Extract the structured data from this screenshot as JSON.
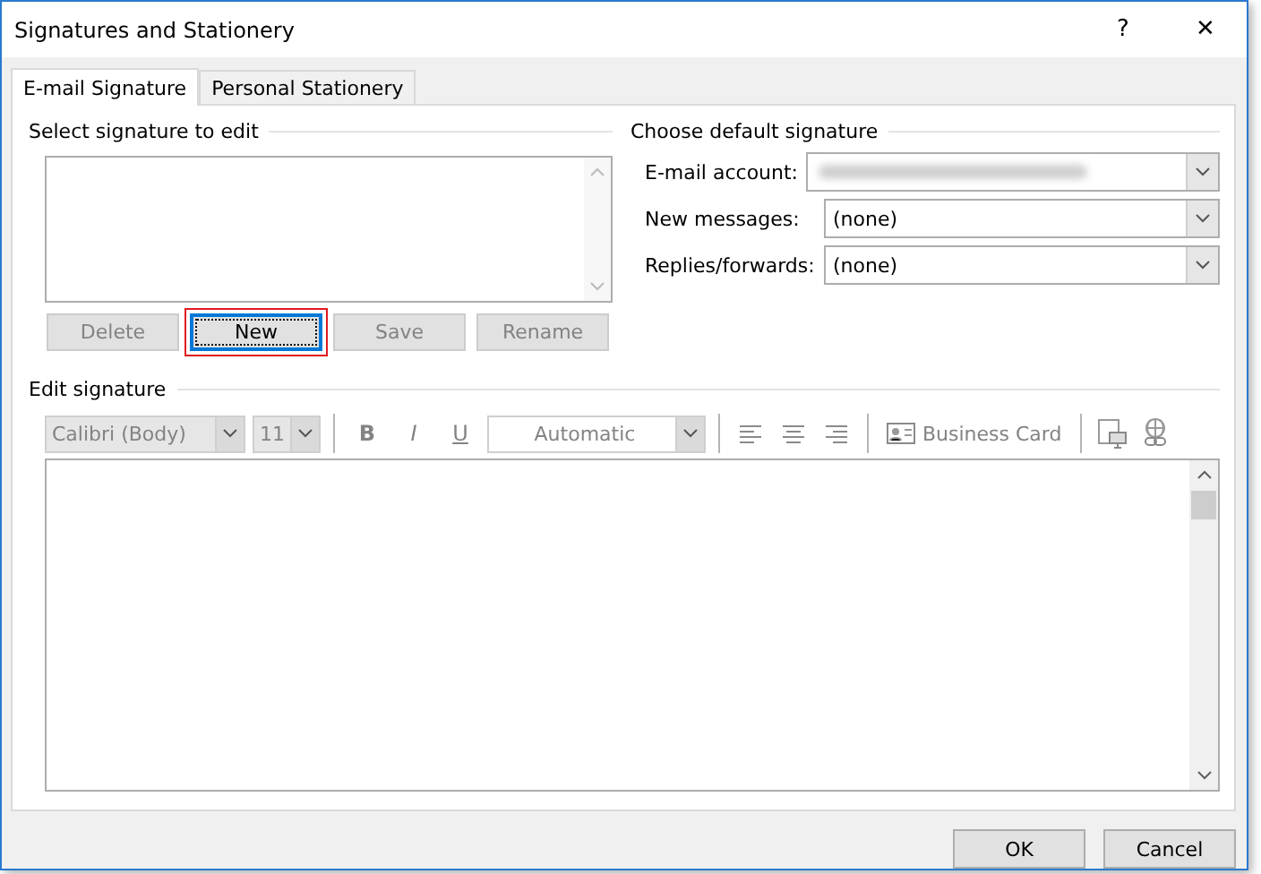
{
  "window": {
    "title": "Signatures and Stationery",
    "help": "?",
    "close": "✕"
  },
  "tabs": [
    {
      "label": "E-mail Signature",
      "selected": true
    },
    {
      "label": "Personal Stationery",
      "selected": false
    }
  ],
  "select_signature": {
    "heading": "Select signature to edit",
    "buttons": [
      {
        "label": "Delete",
        "disabled": true,
        "focused": false,
        "highlighted": false
      },
      {
        "label": "New",
        "disabled": false,
        "focused": true,
        "highlighted": true
      },
      {
        "label": "Save",
        "disabled": true,
        "focused": false,
        "highlighted": false
      },
      {
        "label": "Rename",
        "disabled": true,
        "focused": false,
        "highlighted": false
      }
    ]
  },
  "default_signature": {
    "heading": "Choose default signature",
    "fields": [
      {
        "label": "E-mail account:",
        "redacted": true
      },
      {
        "label": "New messages:",
        "value": "(none)",
        "redacted": false
      },
      {
        "label": "Replies/forwards:",
        "value": "(none)",
        "redacted": false
      }
    ]
  },
  "edit_signature": {
    "heading": "Edit signature",
    "toolbar": [
      {
        "kind": "font_combo",
        "value": "Calibri (Body)"
      },
      {
        "kind": "size_combo",
        "value": "11"
      },
      {
        "kind": "sep"
      },
      {
        "kind": "bold",
        "text": "B"
      },
      {
        "kind": "italic",
        "text": "I"
      },
      {
        "kind": "underline",
        "text": "U"
      },
      {
        "kind": "color_combo",
        "value": "Automatic"
      },
      {
        "kind": "sep"
      },
      {
        "kind": "align_left"
      },
      {
        "kind": "align_center"
      },
      {
        "kind": "align_right"
      },
      {
        "kind": "sep"
      },
      {
        "kind": "card",
        "text": "Business Card"
      },
      {
        "kind": "sep"
      },
      {
        "kind": "picture"
      },
      {
        "kind": "link"
      }
    ]
  },
  "footer_buttons": [
    "OK",
    "Cancel"
  ]
}
